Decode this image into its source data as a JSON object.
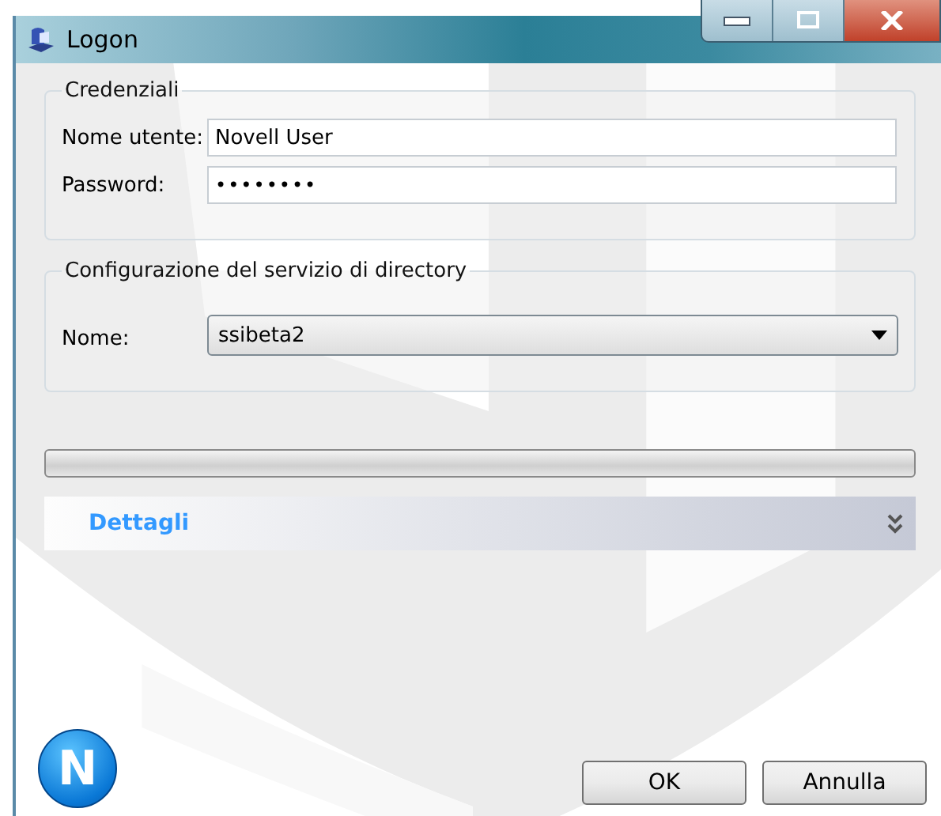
{
  "window": {
    "title": "Logon"
  },
  "credentials": {
    "legend": "Credenziali",
    "fields": [
      {
        "label": "Nome utente:",
        "value": "Novell User",
        "kind": "text"
      },
      {
        "label": "Password:",
        "value": "••••••••",
        "kind": "password"
      }
    ]
  },
  "directory": {
    "legend": "Configurazione del servizio di directory",
    "label": "Nome:",
    "value": "ssibeta2"
  },
  "progress": {
    "level": 0
  },
  "details": {
    "label": "Dettagli",
    "expanded": false
  },
  "logo": {
    "text": "N"
  },
  "buttons": [
    "OK",
    "Annulla"
  ]
}
